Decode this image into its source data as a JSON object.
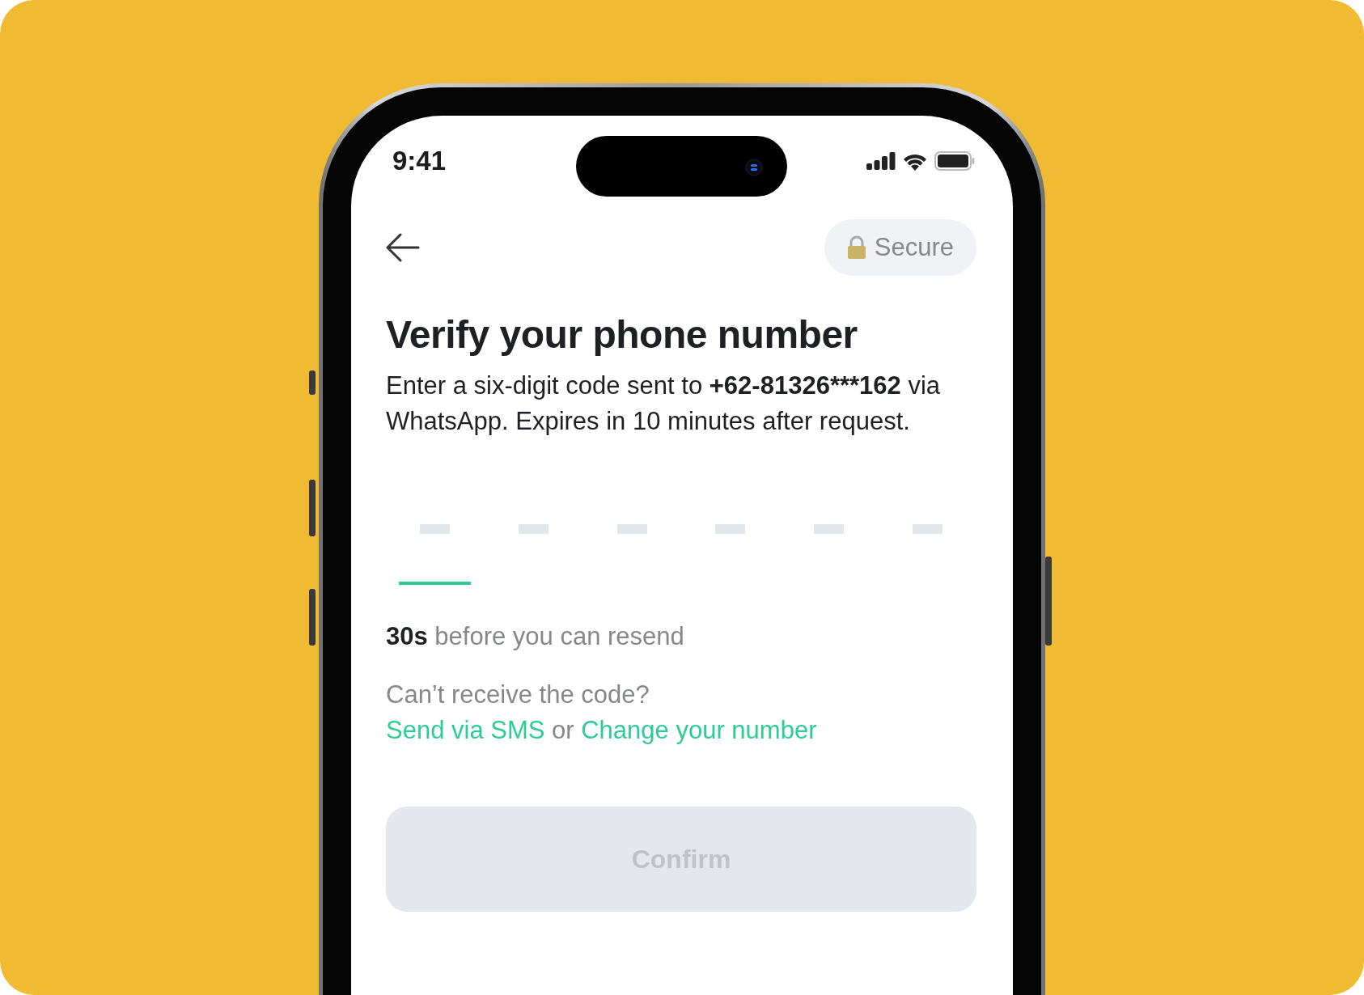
{
  "status_bar": {
    "time": "9:41"
  },
  "header": {
    "badge": "Secure"
  },
  "title": "Verify your phone number",
  "description": {
    "before": "Enter a six-digit code sent to",
    "phone": "+62-81326***162",
    "after": "via WhatsApp. Expires in 10 minutes after request."
  },
  "code_slots": [
    {
      "selected": true
    },
    {
      "selected": false
    },
    {
      "selected": false
    },
    {
      "selected": false
    },
    {
      "selected": false
    },
    {
      "selected": false
    }
  ],
  "resend_text": "**30s** before you can resend",
  "help": {
    "question": "Can’t receive the code?",
    "link_1": "Send via SMS",
    "separator": "or",
    "link_2": "Change your number"
  },
  "confirm_button": {
    "label": "Confirm",
    "disabled": true
  }
}
